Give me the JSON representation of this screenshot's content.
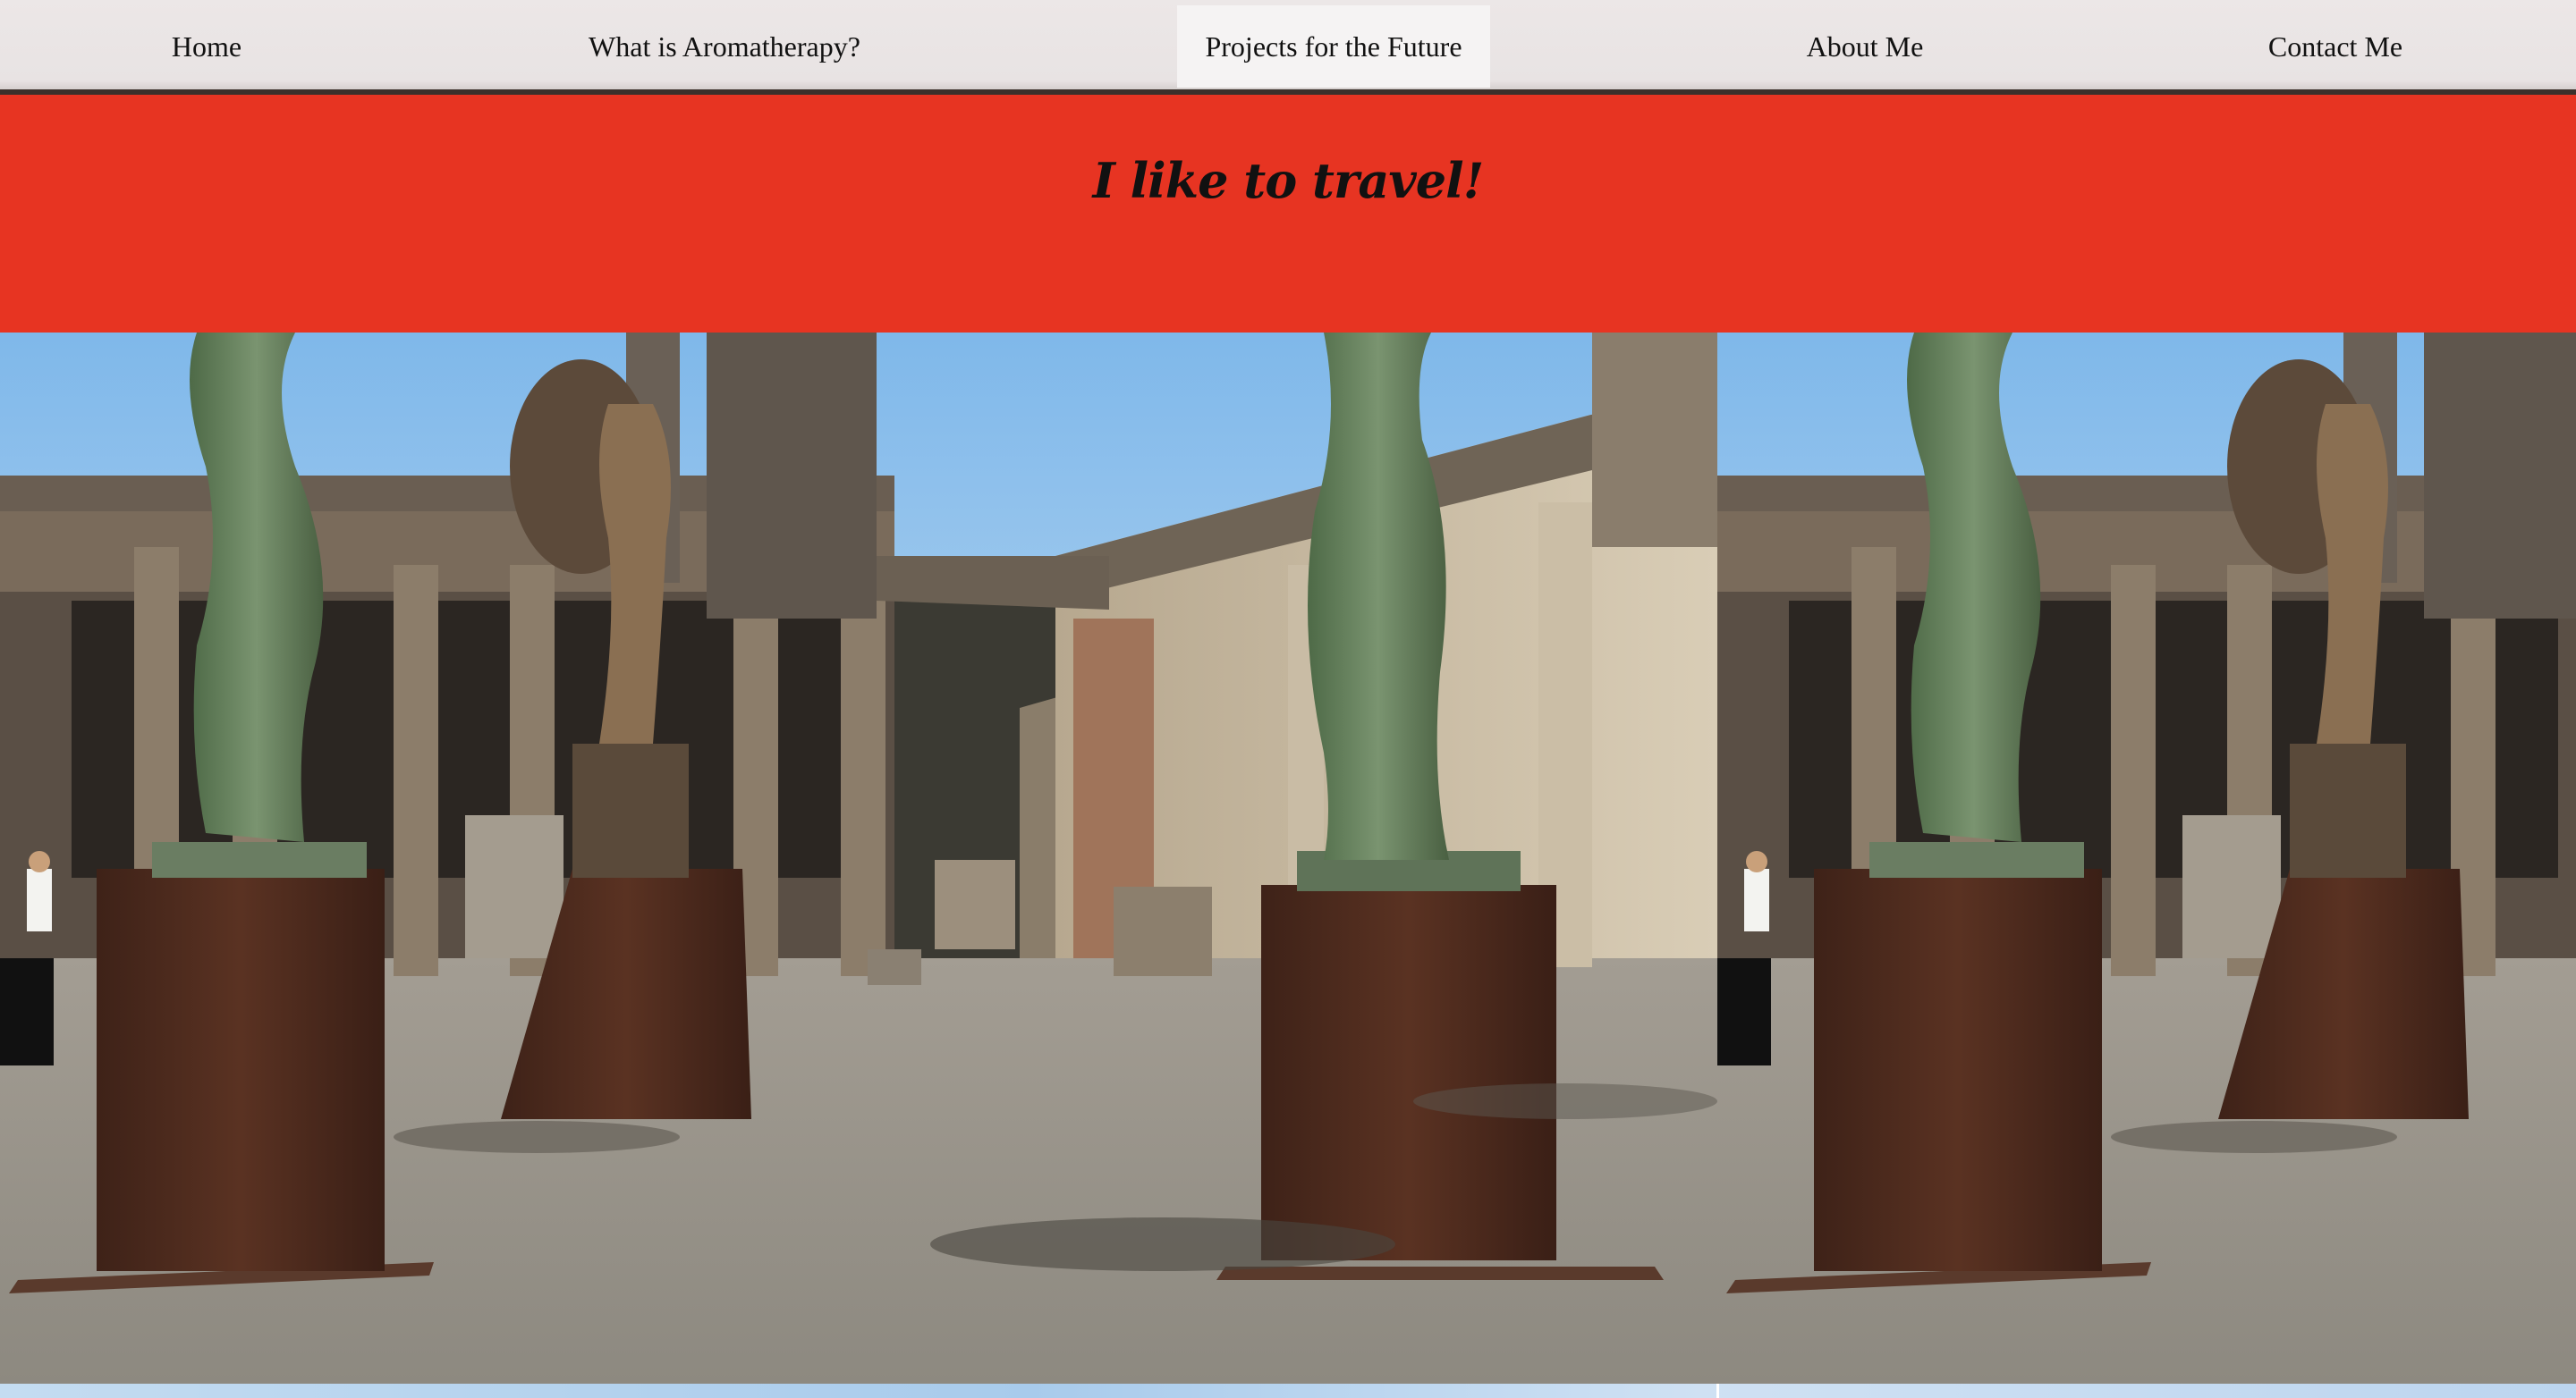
{
  "nav": {
    "items": [
      {
        "label": "Home"
      },
      {
        "label": "What is Aromatherapy?"
      },
      {
        "label": "Projects for the Future",
        "active": true
      },
      {
        "label": "About Me"
      },
      {
        "label": "Contact Me"
      }
    ]
  },
  "hero": {
    "title": "I like to travel!"
  },
  "gallery": {
    "photos": [
      {
        "subject": "pompeii-forum-statues"
      },
      {
        "subject": "pompeii-forum-statues"
      }
    ]
  },
  "colors": {
    "nav_bg": "#e8e3e3",
    "nav_active_bg": "#f5f3f3",
    "hero_bg": "#e73422",
    "text": "#111111"
  }
}
